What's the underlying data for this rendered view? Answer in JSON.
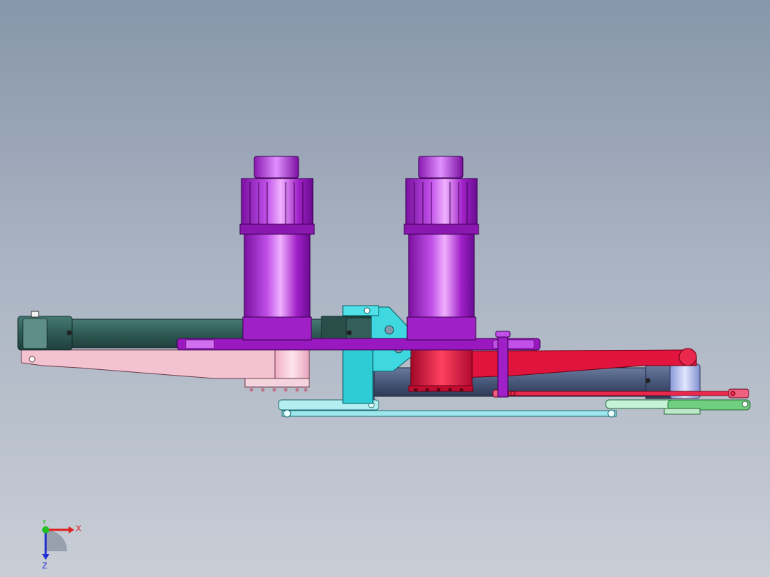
{
  "viewport": {
    "background_top": "#8796aa",
    "background_bottom": "#c9ced6"
  },
  "model": {
    "colors": {
      "motor_purple": "#a020c8",
      "motor_purple_light": "#d070f0",
      "plate_purple": "#9a18c0",
      "arm_dark_teal": "#2f5a55",
      "arm_pink": "#f3c3d2",
      "arm_red": "#e0143c",
      "bracket_cyan": "#40d8e0",
      "link_cyan_light": "#9ee8ec",
      "arm_navy": "#4a5a7a",
      "arm_light_blue": "#b8c4ee",
      "link_mint": "#c6f2d6",
      "link_green": "#6fd080"
    }
  },
  "triad": {
    "x_label": "X",
    "y_label": "Y",
    "z_label": "Z",
    "x_color": "#e02020",
    "y_color": "#20c020",
    "z_color": "#2030d0"
  }
}
